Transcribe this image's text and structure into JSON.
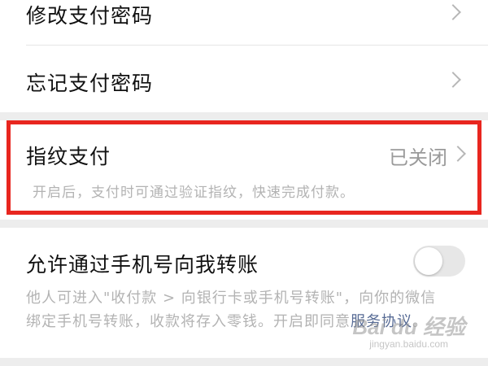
{
  "settings": {
    "change_password": {
      "label": "修改支付密码"
    },
    "forgot_password": {
      "label": "忘记支付密码"
    },
    "fingerprint": {
      "label": "指纹支付",
      "status": "已关闭",
      "description": "开启后，支付时可通过验证指纹，快速完成付款。"
    },
    "phone_transfer": {
      "label": "允许通过手机号向我转账",
      "enabled": false,
      "description_line1": "他人可进入\"收付款 > 向银行卡或手机号转账\"，向你的微信",
      "description_line2_prefix": "绑定手机号转账，收款将存入零钱。开启即同意",
      "agreement_link": "服务协议",
      "description_line2_suffix": "。"
    }
  },
  "watermark": {
    "main": "Bai du 经验",
    "sub": "jingyan.baidu.com"
  },
  "colors": {
    "highlight_border": "#e8261f",
    "link": "#576b95",
    "background": "#ededed"
  },
  "icons": {
    "row_arrow": "chevron-right-icon"
  }
}
